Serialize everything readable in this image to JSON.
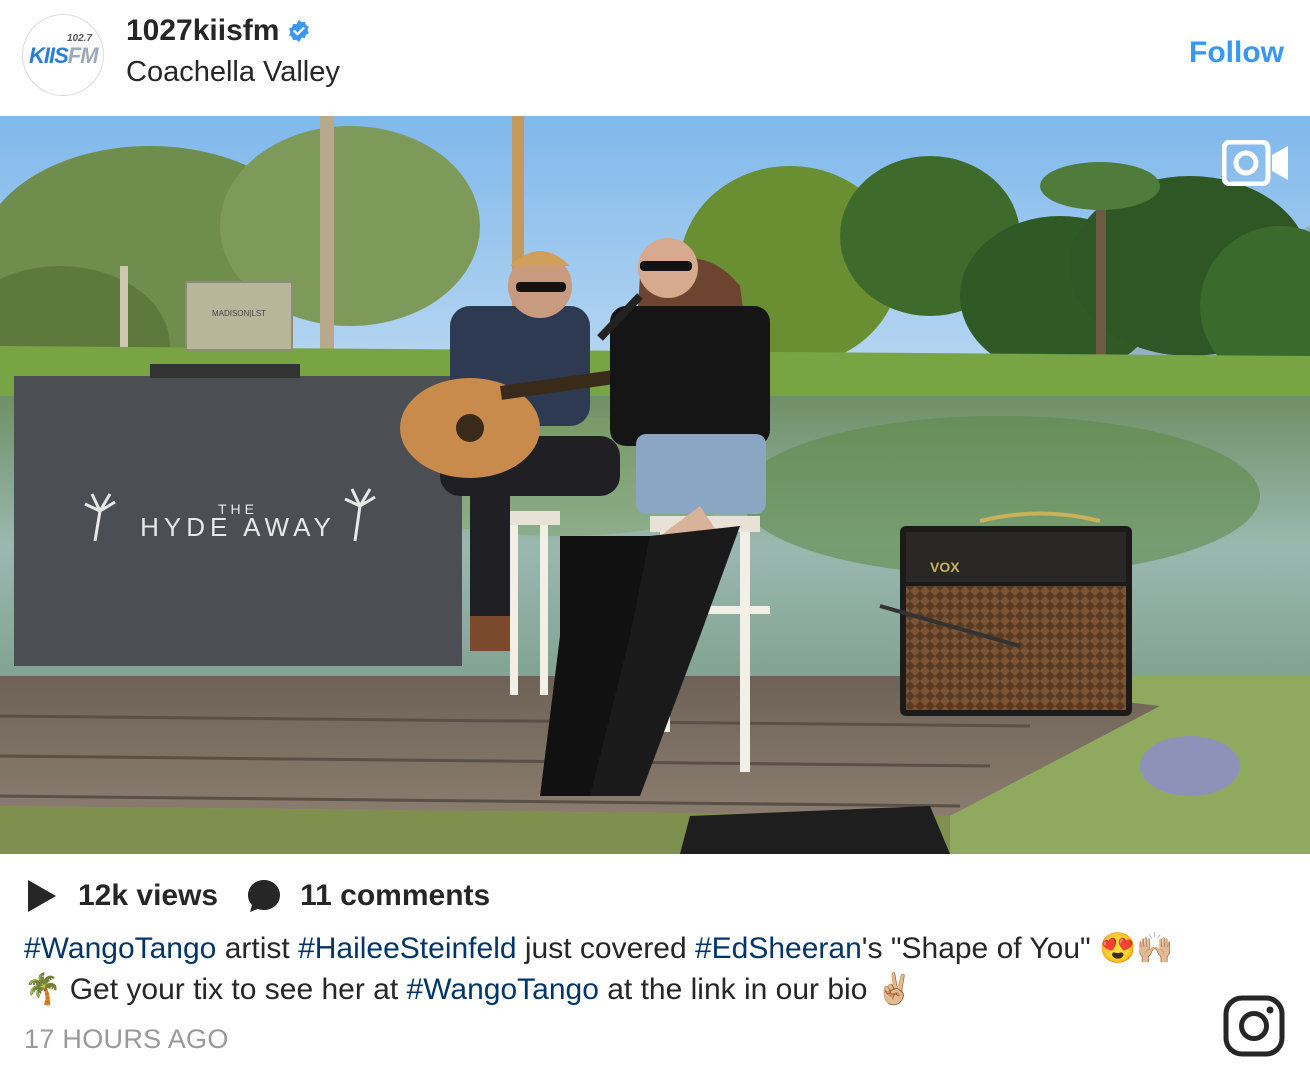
{
  "header": {
    "username": "1027kiisfm",
    "location": "Coachella Valley",
    "follow_label": "Follow",
    "avatar_logo_small": "102.7",
    "avatar_logo_main": "KIIS",
    "avatar_logo_fm": "FM"
  },
  "media": {
    "banner_the": "THE",
    "banner_name": "HYDE AWAY",
    "amp_brand": "VOX",
    "laptop_sticker": "MADISON|LST"
  },
  "stats": {
    "views": "12k views",
    "comments": "11 comments"
  },
  "caption": {
    "tag1": "#WangoTango",
    "t1": " artist ",
    "tag2": "#HaileeSteinfeld",
    "t2": " just covered ",
    "tag3": "#EdSheeran",
    "t3": "'s \"Shape of You\" 😍🙌🏼🌴 Get your tix to see her at ",
    "tag4": "#WangoTango",
    "t4": " at the link in our bio ✌🏼"
  },
  "timestamp": "17 HOURS AGO",
  "colors": {
    "accent": "#3897f0",
    "hashtag": "#003569",
    "verified": "#3897f0"
  },
  "icons": [
    "verified-icon",
    "video-camera-icon",
    "play-icon",
    "comment-icon",
    "instagram-icon"
  ]
}
